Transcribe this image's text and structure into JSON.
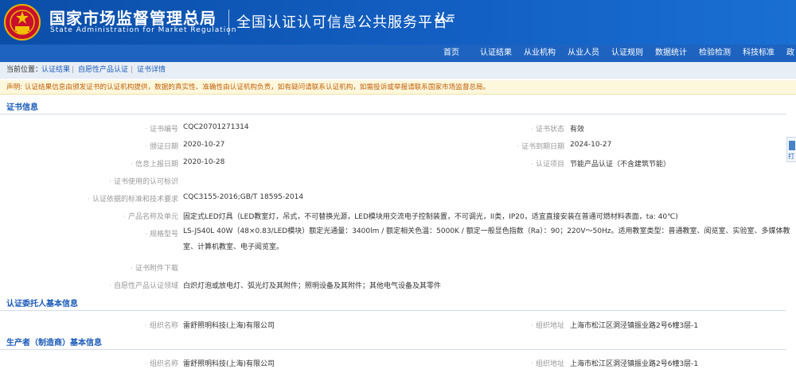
{
  "header": {
    "cn_title": "国家市场监督管理总局",
    "en_title": "State Administration  for  Market Regulation",
    "platform": "全国认证认可信息公共服务平台",
    "logo_text": "认",
    "logo_text2": "云"
  },
  "nav": [
    "首页",
    "认证结果",
    "从业机构",
    "从业人员",
    "认证规则",
    "数据统计",
    "检验检测",
    "科技标准",
    "政"
  ],
  "breadcrumb": {
    "prefix": "当前位置：",
    "items": [
      "认证结果",
      "自愿性产品认证",
      "证书详情"
    ]
  },
  "notice": "声明: 认证结果信息由颁发证书的认证机构提供，数据的真实性、准确性由认证机构负责，如有疑问请联系认证机构，如需投诉或举报请联系国家市场监督总局。",
  "sections": {
    "cert_info": "证书信息",
    "client_info": "认证委托人基本信息",
    "producer_info": "生产者（制造商）基本信息"
  },
  "cert": {
    "no_label": "证书编号",
    "no": "CQC20701271314",
    "status_label": "证书状态",
    "status": "有效",
    "issue_label": "颁证日期",
    "issue": "2020-10-27",
    "expire_label": "证书到期日期",
    "expire": "2024-10-27",
    "report_label": "信息上报日期",
    "report": "2020-10-28",
    "project_label": "认证项目",
    "project": "节能产品认证（不含建筑节能）",
    "mark_label": "证书使用的认可标识",
    "mark": "",
    "std_label": "认证依据的标准和技术要求",
    "std": "CQC3155-2016;GB/T 18595-2014",
    "product_label": "产品名称及单元",
    "product": "固定式LED灯具（LED教室灯，吊式，不可替换光源，LED模块用交流电子控制装置，不可调光，II类，IP20，适宜直接安装在普通可燃材料表面，ta: 40℃)",
    "model_label": "规格型号",
    "model": "LS-JS40L 40W（48×0.83/LED模块）额定光通量：3400lm / 额定相关色温：5000K / 额定一般显色指数（Ra）：90；220V～50Hz。适用教室类型：普通教室、阅览室、实验室、多媒体教室、计算机教室、电子阅览室。",
    "attach_label": "证书附件下载",
    "attach": "",
    "field_label": "自愿性产品认证领域",
    "field": "白炽灯泡或放电灯、弧光灯及其附件；照明设备及其附件；其他电气设备及其零件"
  },
  "client": {
    "name_label": "组织名称",
    "name": "雷舒照明科技(上海)有限公司",
    "addr_label": "组织地址",
    "addr": "上海市松江区洞泾镇振业路2号6幢3层-1"
  },
  "producer": {
    "name_label": "组织名称",
    "name": "雷舒照明科技(上海)有限公司",
    "addr_label": "组织地址",
    "addr": "上海市松江区洞泾镇振业路2号6幢3层-1"
  },
  "side_tab": "打"
}
